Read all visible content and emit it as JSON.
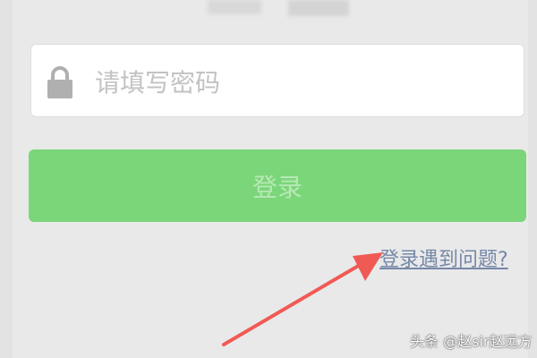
{
  "password_field": {
    "placeholder": "请填写密码",
    "icon": "lock-icon"
  },
  "login_button": {
    "label": "登录"
  },
  "help_link": {
    "label": "登录遇到问题?"
  },
  "annotation": {
    "icon": "red-arrow-icon",
    "color": "#f05a55"
  },
  "watermark": {
    "text": "头条 @赵sir赵远方"
  },
  "colors": {
    "background": "#e9e9e9",
    "button": "#7bd67a",
    "button_text": "#b7e9b4",
    "link": "#7688a8",
    "placeholder": "#c2c2c2"
  }
}
